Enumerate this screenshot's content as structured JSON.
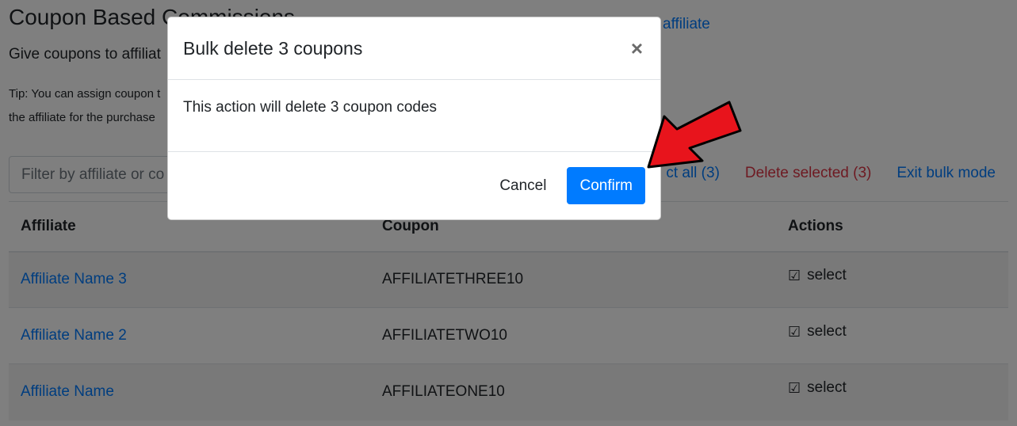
{
  "page": {
    "title": "Coupon Based Commissions",
    "subtitle": "Give coupons to affiliat",
    "assign_link": "affiliate",
    "tip_line1": "Tip: You can assign coupon t",
    "tip_line2": "the affiliate for the purchase"
  },
  "filter": {
    "placeholder": "Filter by affiliate or co"
  },
  "bulk_actions": {
    "select_all": "ct all (3)",
    "delete_selected": "Delete selected (3)",
    "exit_bulk": "Exit bulk mode"
  },
  "table": {
    "headers": [
      "Affiliate",
      "Coupon",
      "Actions"
    ],
    "rows": [
      {
        "affiliate": "Affiliate Name 3",
        "coupon": "AFFILIATETHREE10",
        "action": "select",
        "checked": true
      },
      {
        "affiliate": "Affiliate Name 2",
        "coupon": "AFFILIATETWO10",
        "action": "select",
        "checked": true
      },
      {
        "affiliate": "Affiliate Name",
        "coupon": "AFFILIATEONE10",
        "action": "select",
        "checked": true
      }
    ]
  },
  "modal": {
    "title": "Bulk delete 3 coupons",
    "close_label": "×",
    "body": "This action will delete 3 coupon codes",
    "cancel_label": "Cancel",
    "confirm_label": "Confirm"
  },
  "icons": {
    "checkbox": "checked-checkbox-icon",
    "close": "close-icon",
    "arrow": "red-arrow-annotation"
  },
  "colors": {
    "primary": "#007bff",
    "danger": "#dc3545",
    "arrow": "#e8141c"
  }
}
